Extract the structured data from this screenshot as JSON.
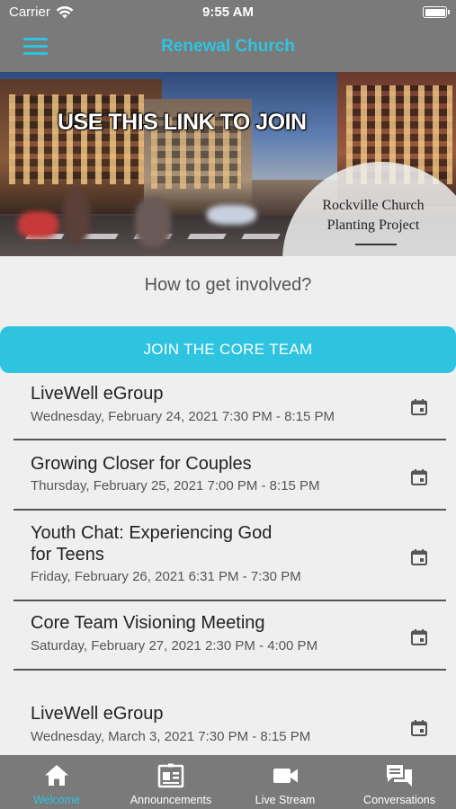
{
  "status_bar": {
    "carrier": "Carrier",
    "time": "9:55 AM"
  },
  "nav": {
    "title": "Renewal Church"
  },
  "banner": {
    "headline": "USE THIS LINK TO JOIN",
    "caption_line1": "Rockville Church",
    "caption_line2": "Planting Project"
  },
  "section_heading": "How to get involved?",
  "cta_label": "JOIN THE CORE TEAM",
  "events": [
    {
      "title": "LiveWell eGroup",
      "time": "Wednesday, February 24, 2021 7:30 PM - 8:15 PM"
    },
    {
      "title": "Growing Closer for Couples",
      "time": "Thursday, February 25, 2021 7:00 PM - 8:15 PM"
    },
    {
      "title_line1": "Youth Chat: Experiencing God",
      "title_line2": "for Teens",
      "time": "Friday, February 26, 2021 6:31 PM - 7:30 PM"
    },
    {
      "title": "Core Team Visioning Meeting",
      "time": "Saturday, February 27, 2021 2:30 PM - 4:00 PM"
    },
    {
      "title": "LiveWell eGroup",
      "time": "Wednesday, March 3, 2021 7:30 PM - 8:15 PM"
    }
  ],
  "tabs": [
    {
      "label": "Welcome",
      "icon": "home-icon",
      "active": true
    },
    {
      "label": "Announcements",
      "icon": "newspaper-icon",
      "active": false
    },
    {
      "label": "Live Stream",
      "icon": "video-camera-icon",
      "active": false
    },
    {
      "label": "Conversations",
      "icon": "chat-bubbles-icon",
      "active": false
    }
  ],
  "colors": {
    "accent": "#2ec4e0",
    "bar_gray": "#7a7a7a",
    "background": "#efefef"
  }
}
